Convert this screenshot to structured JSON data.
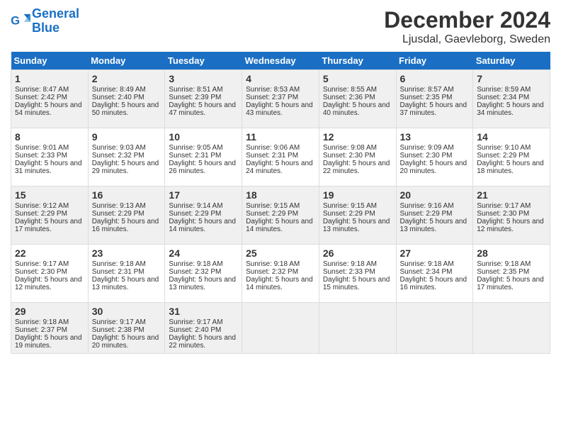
{
  "logo": {
    "line1": "General",
    "line2": "Blue"
  },
  "title": "December 2024",
  "location": "Ljusdal, Gaevleborg, Sweden",
  "days_of_week": [
    "Sunday",
    "Monday",
    "Tuesday",
    "Wednesday",
    "Thursday",
    "Friday",
    "Saturday"
  ],
  "weeks": [
    [
      {
        "day": 1,
        "sunrise": "8:47 AM",
        "sunset": "2:42 PM",
        "daylight": "5 hours and 54 minutes."
      },
      {
        "day": 2,
        "sunrise": "8:49 AM",
        "sunset": "2:40 PM",
        "daylight": "5 hours and 50 minutes."
      },
      {
        "day": 3,
        "sunrise": "8:51 AM",
        "sunset": "2:39 PM",
        "daylight": "5 hours and 47 minutes."
      },
      {
        "day": 4,
        "sunrise": "8:53 AM",
        "sunset": "2:37 PM",
        "daylight": "5 hours and 43 minutes."
      },
      {
        "day": 5,
        "sunrise": "8:55 AM",
        "sunset": "2:36 PM",
        "daylight": "5 hours and 40 minutes."
      },
      {
        "day": 6,
        "sunrise": "8:57 AM",
        "sunset": "2:35 PM",
        "daylight": "5 hours and 37 minutes."
      },
      {
        "day": 7,
        "sunrise": "8:59 AM",
        "sunset": "2:34 PM",
        "daylight": "5 hours and 34 minutes."
      }
    ],
    [
      {
        "day": 8,
        "sunrise": "9:01 AM",
        "sunset": "2:33 PM",
        "daylight": "5 hours and 31 minutes."
      },
      {
        "day": 9,
        "sunrise": "9:03 AM",
        "sunset": "2:32 PM",
        "daylight": "5 hours and 29 minutes."
      },
      {
        "day": 10,
        "sunrise": "9:05 AM",
        "sunset": "2:31 PM",
        "daylight": "5 hours and 26 minutes."
      },
      {
        "day": 11,
        "sunrise": "9:06 AM",
        "sunset": "2:31 PM",
        "daylight": "5 hours and 24 minutes."
      },
      {
        "day": 12,
        "sunrise": "9:08 AM",
        "sunset": "2:30 PM",
        "daylight": "5 hours and 22 minutes."
      },
      {
        "day": 13,
        "sunrise": "9:09 AM",
        "sunset": "2:30 PM",
        "daylight": "5 hours and 20 minutes."
      },
      {
        "day": 14,
        "sunrise": "9:10 AM",
        "sunset": "2:29 PM",
        "daylight": "5 hours and 18 minutes."
      }
    ],
    [
      {
        "day": 15,
        "sunrise": "9:12 AM",
        "sunset": "2:29 PM",
        "daylight": "5 hours and 17 minutes."
      },
      {
        "day": 16,
        "sunrise": "9:13 AM",
        "sunset": "2:29 PM",
        "daylight": "5 hours and 16 minutes."
      },
      {
        "day": 17,
        "sunrise": "9:14 AM",
        "sunset": "2:29 PM",
        "daylight": "5 hours and 14 minutes."
      },
      {
        "day": 18,
        "sunrise": "9:15 AM",
        "sunset": "2:29 PM",
        "daylight": "5 hours and 14 minutes."
      },
      {
        "day": 19,
        "sunrise": "9:15 AM",
        "sunset": "2:29 PM",
        "daylight": "5 hours and 13 minutes."
      },
      {
        "day": 20,
        "sunrise": "9:16 AM",
        "sunset": "2:29 PM",
        "daylight": "5 hours and 13 minutes."
      },
      {
        "day": 21,
        "sunrise": "9:17 AM",
        "sunset": "2:30 PM",
        "daylight": "5 hours and 12 minutes."
      }
    ],
    [
      {
        "day": 22,
        "sunrise": "9:17 AM",
        "sunset": "2:30 PM",
        "daylight": "5 hours and 12 minutes."
      },
      {
        "day": 23,
        "sunrise": "9:18 AM",
        "sunset": "2:31 PM",
        "daylight": "5 hours and 13 minutes."
      },
      {
        "day": 24,
        "sunrise": "9:18 AM",
        "sunset": "2:32 PM",
        "daylight": "5 hours and 13 minutes."
      },
      {
        "day": 25,
        "sunrise": "9:18 AM",
        "sunset": "2:32 PM",
        "daylight": "5 hours and 14 minutes."
      },
      {
        "day": 26,
        "sunrise": "9:18 AM",
        "sunset": "2:33 PM",
        "daylight": "5 hours and 15 minutes."
      },
      {
        "day": 27,
        "sunrise": "9:18 AM",
        "sunset": "2:34 PM",
        "daylight": "5 hours and 16 minutes."
      },
      {
        "day": 28,
        "sunrise": "9:18 AM",
        "sunset": "2:35 PM",
        "daylight": "5 hours and 17 minutes."
      }
    ],
    [
      {
        "day": 29,
        "sunrise": "9:18 AM",
        "sunset": "2:37 PM",
        "daylight": "5 hours and 19 minutes."
      },
      {
        "day": 30,
        "sunrise": "9:17 AM",
        "sunset": "2:38 PM",
        "daylight": "5 hours and 20 minutes."
      },
      {
        "day": 31,
        "sunrise": "9:17 AM",
        "sunset": "2:40 PM",
        "daylight": "5 hours and 22 minutes."
      },
      null,
      null,
      null,
      null
    ]
  ]
}
